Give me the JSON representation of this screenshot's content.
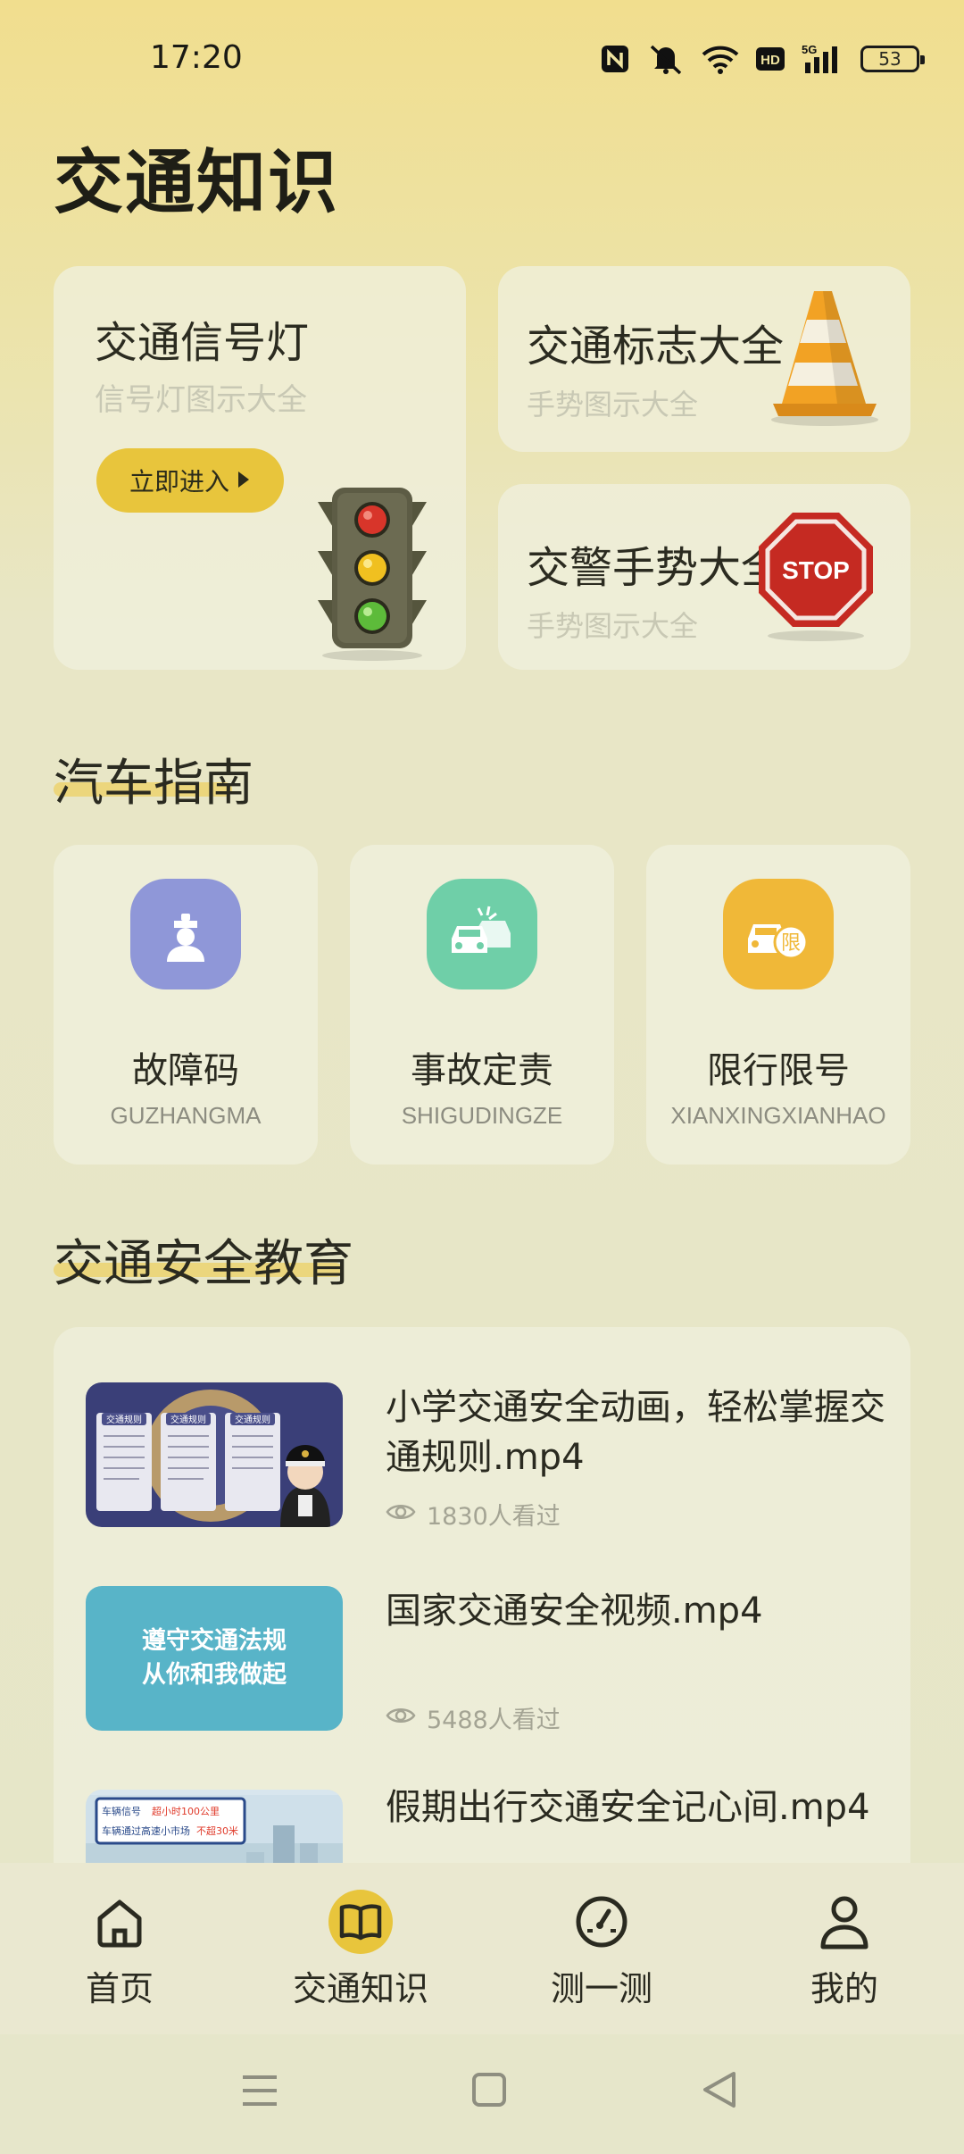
{
  "status_bar": {
    "time": "17:20",
    "battery": "53"
  },
  "page": {
    "title": "交通知识"
  },
  "feature_cards": [
    {
      "title": "交通信号灯",
      "subtitle": "信号灯图示大全",
      "button": "立即进入"
    },
    {
      "title": "交通标志大全",
      "subtitle": "手势图示大全"
    },
    {
      "title": "交警手势大全",
      "subtitle": "手势图示大全",
      "sign_text": "STOP"
    }
  ],
  "car_guide": {
    "title": "汽车指南",
    "items": [
      {
        "name": "故障码",
        "pinyin": "GUZHANGMA",
        "icon": "mechanic-icon",
        "color": "#8f97d8"
      },
      {
        "name": "事故定责",
        "pinyin": "SHIGUDINGZE",
        "icon": "car-accident-icon",
        "color": "#6fcfa8"
      },
      {
        "name": "限行限号",
        "pinyin": "XIANXINGXIANHAO",
        "icon": "car-restriction-icon",
        "color": "#f0b838",
        "badge": "限"
      }
    ]
  },
  "safety_education": {
    "title": "交通安全教育",
    "videos": [
      {
        "title": "小学交通安全动画，轻松掌握交通规则.mp4",
        "views": "1830人看过",
        "thumb_labels": [
          "交通规则",
          "交通规则",
          "交通规则"
        ]
      },
      {
        "title": "国家交通安全视频.mp4",
        "views": "5488人看过",
        "thumb_text": [
          "遵守交通法规",
          "从你和我做起"
        ]
      },
      {
        "title": "假期出行交通安全记心间.mp4",
        "thumb_text": [
          "车辆信号",
          "超小时100公里",
          "车辆通过高速小市场",
          "不超30米"
        ]
      }
    ]
  },
  "tabbar": [
    {
      "label": "首页",
      "icon": "home-icon"
    },
    {
      "label": "交通知识",
      "icon": "book-icon",
      "active": true
    },
    {
      "label": "测一测",
      "icon": "gauge-icon"
    },
    {
      "label": "我的",
      "icon": "user-icon"
    }
  ],
  "colors": {
    "accent": "#e8c53c",
    "background": "#e8e6c6"
  }
}
